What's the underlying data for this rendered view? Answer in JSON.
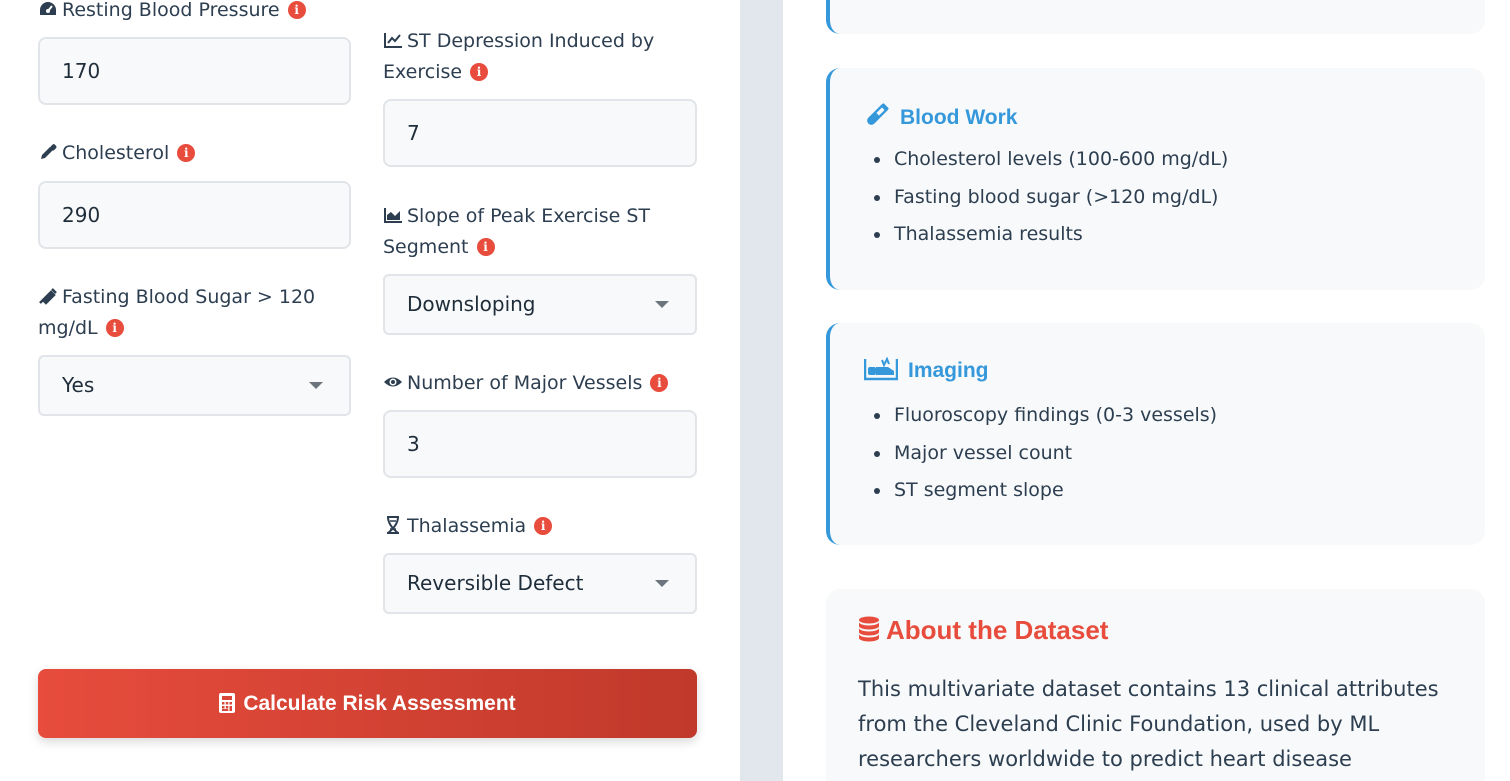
{
  "form": {
    "resting_bp": {
      "label": "Resting Blood Pressure",
      "value": "170"
    },
    "cholesterol": {
      "label": "Cholesterol",
      "value": "290"
    },
    "fasting_sugar": {
      "label_line1": "Fasting Blood Sugar > 120",
      "label_line2": "mg/dL",
      "selected": "Yes"
    },
    "st_depression": {
      "label_line1": "ST Depression Induced by",
      "label_line2": "Exercise",
      "value": "7"
    },
    "slope": {
      "label_line1": "Slope of Peak Exercise ST",
      "label_line2": "Segment",
      "selected": "Downsloping"
    },
    "vessels": {
      "label": "Number of Major Vessels",
      "value": "3"
    },
    "thalassemia": {
      "label": "Thalassemia",
      "selected": "Reversible Defect"
    },
    "info_glyph": "i",
    "submit_label": "Calculate Risk Assessment"
  },
  "cards": {
    "blood_work": {
      "title": "Blood Work",
      "items": [
        "Cholesterol levels (100-600 mg/dL)",
        "Fasting blood sugar (>120 mg/dL)",
        "Thalassemia results"
      ]
    },
    "imaging": {
      "title": "Imaging",
      "items": [
        "Fluoroscopy findings (0-3 vessels)",
        "Major vessel count",
        "ST segment slope"
      ]
    },
    "dataset": {
      "title": "About the Dataset",
      "text": "This multivariate dataset contains 13 clinical attributes from the Cleveland Clinic Foundation, used by ML researchers worldwide to predict heart disease"
    }
  },
  "colors": {
    "accent_blue": "#3498db",
    "accent_red": "#e74c3c",
    "gutter": "#e2e6ed"
  },
  "icons": {
    "resting_bp": "gauge-icon",
    "cholesterol": "eyedropper-icon",
    "fasting_sugar": "syringe-icon",
    "st_depression": "chart-line-icon",
    "slope": "chart-area-icon",
    "vessels": "eye-icon",
    "thalassemia": "dna-icon",
    "submit": "calculator-icon",
    "blood_work": "vial-icon",
    "imaging": "x-ray-icon",
    "dataset": "database-icon"
  }
}
